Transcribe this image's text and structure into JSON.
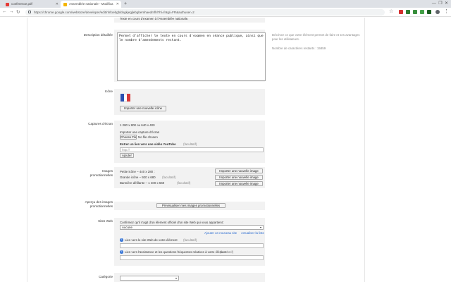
{
  "browser": {
    "tabs": [
      {
        "title": "conference.pdf",
        "active": false,
        "favicon_color": "#e53935"
      },
      {
        "title": "Assemblée nationale - Modifica",
        "active": true,
        "favicon_color": "#f4b400"
      }
    ],
    "url": "https://chrome.google.com/webstore/developer/edit/nhfoebgbldogkjegjlebgbemhaedmfhl?hl=fr&gl=FR&authuser=2",
    "tooltip": "Modification du Règlement de l'Assemblée nationale"
  },
  "form": {
    "top_remnant": "Texte en cours d'examen à l'Assemblée nationale.",
    "description": {
      "label": "Description détaillée",
      "value": "Permet d'afficher le texte en cours d'examen en séance publique, ainsi que le nombre d'amendements restant.",
      "help": "Décrivez ce que votre élément permet de faire et ses avantages pour les utilisateurs.",
      "counter": "Nombre de caractères restants : 15859"
    },
    "icon": {
      "label": "Icône",
      "upload_button": "Importer une nouvelle icône"
    },
    "screenshots": {
      "label": "Captures d'écran",
      "size": "1 280 x 800 ou 640 x 400",
      "upload_label": "Importer une capture d'écran",
      "choose_file": "Choose File",
      "no_file": "No file chosen",
      "youtube_label": "Entrer un lien vers une vidéo YouTube",
      "optional": "(facultatif)",
      "url_placeholder": "http://",
      "add_button": "Ajouter"
    },
    "promo": {
      "label": "Images promotionnelles",
      "small_tile": "Petite icône – 440 x 280 :",
      "large_tile": "Grande icône – 920 x 680",
      "marquee": "Bannière défilante – 1 400 x 560",
      "optional": "(facultatif)",
      "upload_button": "Importer une nouvelle image"
    },
    "preview": {
      "label": "Aperçu des images promotionnelles",
      "button": "Prévisualiser mes images promotionnelles"
    },
    "website": {
      "label": "Sites Web",
      "confirm": "Confirmez qu'il s'agit d'un élément officiel d'un site Web qui vous appartient :",
      "select_value": "Aucune",
      "add_site": "Ajouter un nouveau site",
      "refresh": "Actualiser la liste",
      "website_label": "Lien vers le site Web de votre élément",
      "faq_label": "Lien vers l'assistance et les questions fréquentes relatives à votre élément",
      "optional": "(facultatif)"
    },
    "category": {
      "label": "Catégorie"
    }
  },
  "colors": {
    "tabstrip": "#dee1e6",
    "panel": "#f2f2f2",
    "link": "#2a6bd1",
    "help_icon": "#3b78d8"
  }
}
